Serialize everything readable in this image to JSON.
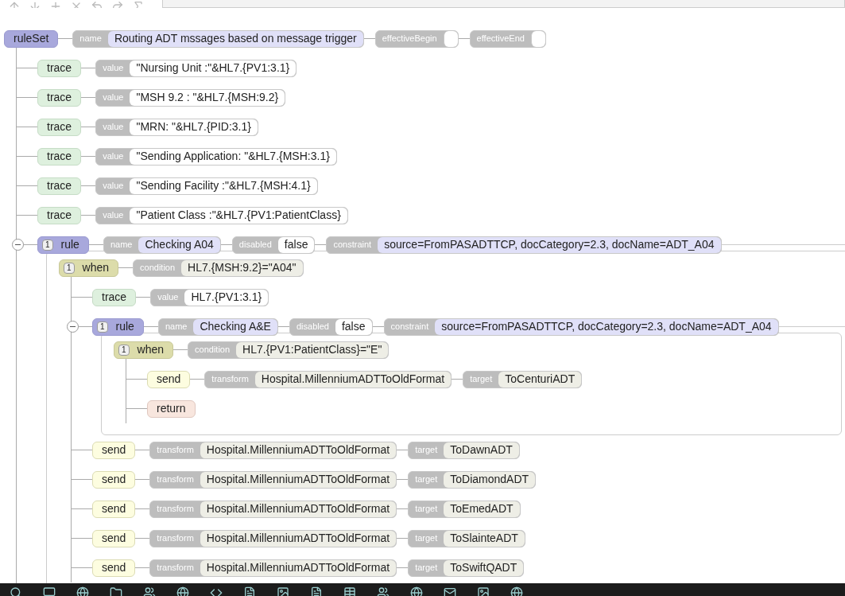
{
  "tree": {
    "kind": "ruleSet",
    "label": "ruleSet",
    "fields": [
      {
        "kind": "name",
        "label": "name",
        "value": "Routing ADT mssages based on message trigger"
      },
      {
        "kind": "empty",
        "label": "effectiveBegin"
      },
      {
        "kind": "empty",
        "label": "effectiveEnd"
      }
    ],
    "children": [
      {
        "kind": "trace",
        "label": "trace",
        "fields": [
          {
            "kind": "value",
            "label": "value",
            "value": "\"Nursing Unit :\"&HL7.{PV1:3.1}"
          }
        ]
      },
      {
        "kind": "trace",
        "label": "trace",
        "fields": [
          {
            "kind": "value",
            "label": "value",
            "value": "\"MSH 9.2 : \"&HL7.{MSH:9.2}"
          }
        ]
      },
      {
        "kind": "trace",
        "label": "trace",
        "fields": [
          {
            "kind": "value",
            "label": "value",
            "value": "\"MRN: \"&HL7.{PID:3.1}"
          }
        ]
      },
      {
        "kind": "trace",
        "label": "trace",
        "fields": [
          {
            "kind": "value",
            "label": "value",
            "value": "\"Sending Application: \"&HL7.{MSH:3.1}"
          }
        ]
      },
      {
        "kind": "trace",
        "label": "trace",
        "fields": [
          {
            "kind": "value",
            "label": "value",
            "value": "\"Sending Facility :\"&HL7.{MSH:4.1}"
          }
        ]
      },
      {
        "kind": "trace",
        "label": "trace",
        "fields": [
          {
            "kind": "value",
            "label": "value",
            "value": "\"Patient Class :\"&HL7.{PV1:PatientClass}"
          }
        ]
      },
      {
        "kind": "rule",
        "label": "rule",
        "count": "1",
        "expanded": true,
        "fields": [
          {
            "kind": "name",
            "label": "name",
            "value": "Checking A04"
          },
          {
            "kind": "value",
            "label": "disabled",
            "value": "false"
          },
          {
            "kind": "name",
            "label": "constraint",
            "value": "source=FromPASADTTCP, docCategory=2.3, docName=ADT_A04"
          }
        ],
        "children": [
          {
            "kind": "when",
            "label": "when",
            "count": "1",
            "fields": [
              {
                "kind": "condition",
                "label": "condition",
                "value": "HL7.{MSH:9.2}=\"A04\""
              }
            ],
            "children": [
              {
                "kind": "trace",
                "label": "trace",
                "fields": [
                  {
                    "kind": "value",
                    "label": "value",
                    "value": "HL7.{PV1:3.1}"
                  }
                ]
              },
              {
                "kind": "rule",
                "label": "rule",
                "count": "1",
                "expanded": true,
                "fields": [
                  {
                    "kind": "name",
                    "label": "name",
                    "value": "Checking A&E"
                  },
                  {
                    "kind": "value",
                    "label": "disabled",
                    "value": "false"
                  },
                  {
                    "kind": "name",
                    "label": "constraint",
                    "value": "source=FromPASADTTCP, docCategory=2.3, docName=ADT_A04"
                  }
                ],
                "children": [
                  {
                    "kind": "when",
                    "label": "when",
                    "count": "1",
                    "fields": [
                      {
                        "kind": "condition",
                        "label": "condition",
                        "value": "HL7.{PV1:PatientClass}=\"E\""
                      }
                    ],
                    "children": [
                      {
                        "kind": "send",
                        "label": "send",
                        "fields": [
                          {
                            "kind": "condition",
                            "label": "transform",
                            "value": "Hospital.MillenniumADTToOldFormat"
                          },
                          {
                            "kind": "condition",
                            "label": "target",
                            "value": "ToCenturiADT"
                          }
                        ]
                      },
                      {
                        "kind": "return",
                        "label": "return"
                      }
                    ]
                  }
                ]
              },
              {
                "kind": "send",
                "label": "send",
                "fields": [
                  {
                    "kind": "condition",
                    "label": "transform",
                    "value": "Hospital.MillenniumADTToOldFormat"
                  },
                  {
                    "kind": "condition",
                    "label": "target",
                    "value": "ToDawnADT"
                  }
                ]
              },
              {
                "kind": "send",
                "label": "send",
                "fields": [
                  {
                    "kind": "condition",
                    "label": "transform",
                    "value": "Hospital.MillenniumADTToOldFormat"
                  },
                  {
                    "kind": "condition",
                    "label": "target",
                    "value": "ToDiamondADT"
                  }
                ]
              },
              {
                "kind": "send",
                "label": "send",
                "fields": [
                  {
                    "kind": "condition",
                    "label": "transform",
                    "value": "Hospital.MillenniumADTToOldFormat"
                  },
                  {
                    "kind": "condition",
                    "label": "target",
                    "value": "ToEmedADT"
                  }
                ]
              },
              {
                "kind": "send",
                "label": "send",
                "fields": [
                  {
                    "kind": "condition",
                    "label": "transform",
                    "value": "Hospital.MillenniumADTToOldFormat"
                  },
                  {
                    "kind": "condition",
                    "label": "target",
                    "value": "ToSlainteADT"
                  }
                ]
              },
              {
                "kind": "send",
                "label": "send",
                "fields": [
                  {
                    "kind": "condition",
                    "label": "transform",
                    "value": "Hospital.MillenniumADTToOldFormat"
                  },
                  {
                    "kind": "condition",
                    "label": "target",
                    "value": "ToSwiftQADT"
                  }
                ]
              }
            ]
          }
        ]
      }
    ]
  }
}
